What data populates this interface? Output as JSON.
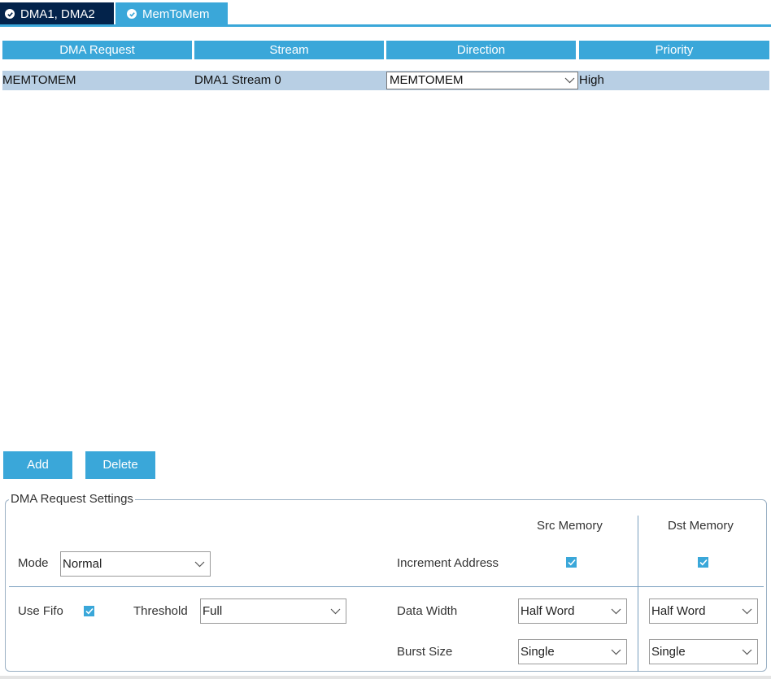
{
  "tabs": [
    {
      "label": "DMA1, DMA2",
      "active": true
    },
    {
      "label": "MemToMem",
      "active": false
    }
  ],
  "table": {
    "headers": [
      "DMA Request",
      "Stream",
      "Direction",
      "Priority"
    ],
    "rows": [
      {
        "request": "MEMTOMEM",
        "stream": "DMA1 Stream 0",
        "direction": "MEMTOMEM",
        "priority": "High"
      }
    ]
  },
  "buttons": {
    "add": "Add",
    "delete": "Delete"
  },
  "settings": {
    "legend": "DMA Request Settings",
    "mode": {
      "label": "Mode",
      "value": "Normal"
    },
    "use_fifo": {
      "label": "Use Fifo",
      "checked": true
    },
    "threshold": {
      "label": "Threshold",
      "value": "Full"
    },
    "columns": {
      "src": "Src Memory",
      "dst": "Dst Memory"
    },
    "increment_address": {
      "label": "Increment Address",
      "src_checked": true,
      "dst_checked": true
    },
    "data_width": {
      "label": "Data Width",
      "src": "Half Word",
      "dst": "Half Word"
    },
    "burst_size": {
      "label": "Burst Size",
      "src": "Single",
      "dst": "Single"
    }
  },
  "colors": {
    "accent": "#3aa7d9",
    "tab_dark": "#03234b",
    "row_selected": "#b8cfe4"
  },
  "icons": {
    "tab_status": "check-circle-icon",
    "dropdown": "chevron-down-icon",
    "checkbox": "checkmark-icon"
  }
}
